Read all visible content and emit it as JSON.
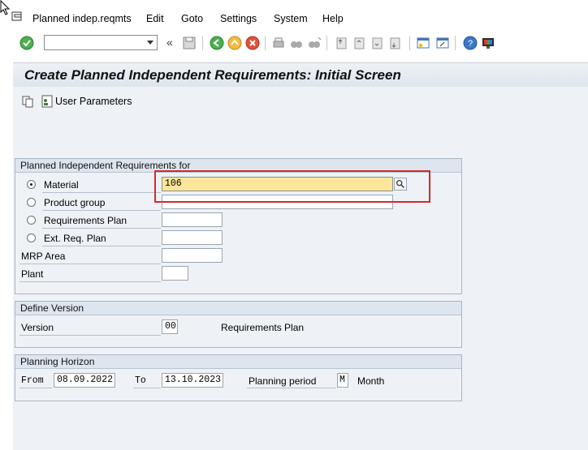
{
  "menu": {
    "items": [
      "Planned indep.reqmts",
      "Edit",
      "Goto",
      "Settings",
      "System",
      "Help"
    ]
  },
  "toolbar": {
    "command_field_value": "",
    "icons": [
      "enter-icon",
      "back-arrows-icon",
      "save-icon",
      "back-icon",
      "exit-icon",
      "cancel-icon",
      "print-icon",
      "find-icon",
      "find-next-icon",
      "first-page-icon",
      "previous-page-icon",
      "next-page-icon",
      "last-page-icon",
      "create-session-icon",
      "shortcut-icon",
      "help-icon",
      "customize-layout-icon"
    ]
  },
  "title": "Create Planned Independent Requirements: Initial Screen",
  "app_toolbar": {
    "user_parameters_label": "User Parameters"
  },
  "groups": {
    "pir_for": {
      "header": "Planned Independent Requirements for",
      "material_label": "Material",
      "material_value": "106",
      "product_group_label": "Product group",
      "req_plan_label": "Requirements Plan",
      "ext_req_plan_label": "Ext. Req. Plan",
      "mrp_area_label": "MRP Area",
      "plant_label": "Plant",
      "selected": "Material"
    },
    "define_version": {
      "header": "Define Version",
      "version_label": "Version",
      "version_value": "00",
      "version_text": "Requirements Plan"
    },
    "planning_horizon": {
      "header": "Planning Horizon",
      "from_label": "From",
      "from_value": "08.09.2022",
      "to_label": "To",
      "to_value": "13.10.2023",
      "period_label": "Planning period",
      "period_value": "M",
      "period_text": "Month"
    }
  },
  "colors": {
    "highlight_field": "#fbe69b",
    "annotation_box": "#d42a2a",
    "panel_bg": "#eef2f6"
  }
}
